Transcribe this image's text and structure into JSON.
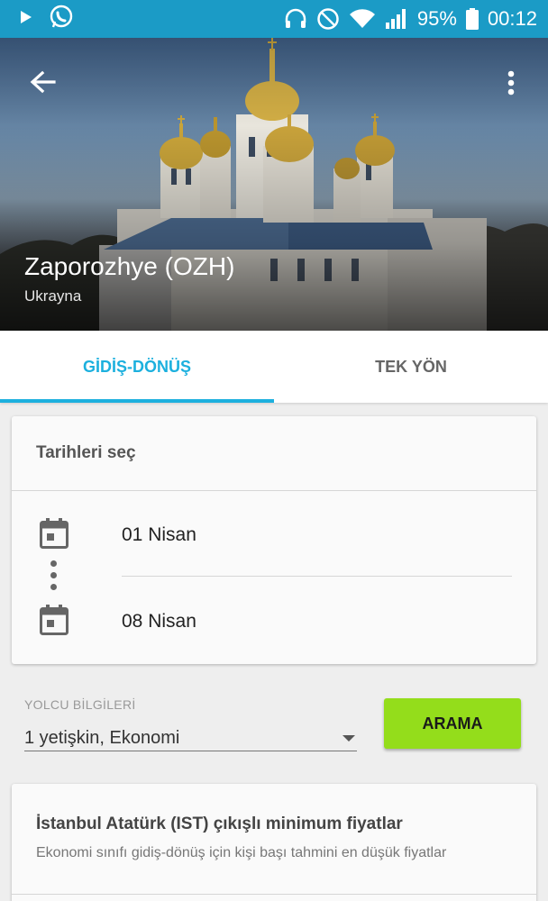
{
  "status_bar": {
    "battery": "95%",
    "time": "00:12",
    "icons": [
      "play-icon",
      "whatsapp-icon",
      "headset-icon",
      "do-not-disturb-icon",
      "wifi-icon",
      "signal-icon",
      "battery-icon"
    ]
  },
  "hero": {
    "city": "Zaporozhye (OZH)",
    "country": "Ukrayna"
  },
  "tabs": [
    {
      "label": "GİDİŞ-DÖNÜŞ",
      "active": true
    },
    {
      "label": "TEK YÖN",
      "active": false
    }
  ],
  "dates": {
    "header": "Tarihleri seç",
    "depart": "01 Nisan",
    "return": "08 Nisan"
  },
  "passenger": {
    "label": "YOLCU BİLGİLERİ",
    "value": "1 yetişkin, Ekonomi"
  },
  "search_button": "ARAMA",
  "info": {
    "title": "İstanbul Atatürk (IST) çıkışlı minimum fiyatlar",
    "subtitle": "Ekonomi sınıfı gidiş-dönüş için kişi başı tahmini en düşük fiyatlar"
  },
  "colors": {
    "status_bar": "#1b9bc6",
    "accent": "#1cb0de",
    "search_button": "#94dd1b"
  }
}
